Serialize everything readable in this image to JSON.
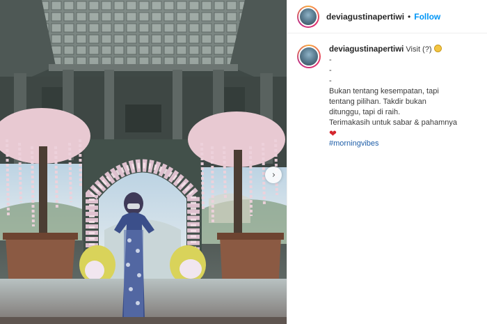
{
  "post": {
    "username": "deviagustinapertiwi",
    "separator": "•",
    "follow_label": "Follow",
    "caption": {
      "username": "deviagustinapertiwi",
      "first_line": "Visit (?)",
      "spacer_lines": [
        "-",
        "-",
        "-"
      ],
      "text_line_1": "Bukan tentang kesempatan, tapi",
      "text_line_2": "tentang pilihan. Takdir bukan",
      "text_line_3": "ditunggu, tapi di raih.",
      "text_line_4": "Terimakasih untuk sabar & pahamnya",
      "heart": "❤",
      "hashtag": "#morningvibes"
    }
  },
  "icons": {
    "next": "chevron-right-icon",
    "heart": "heart-icon",
    "emoji": "sweat-smile-emoji-icon"
  },
  "colors": {
    "follow": "#0095f6",
    "hashtag": "#1e5ea8",
    "heart": "#d4262e"
  }
}
